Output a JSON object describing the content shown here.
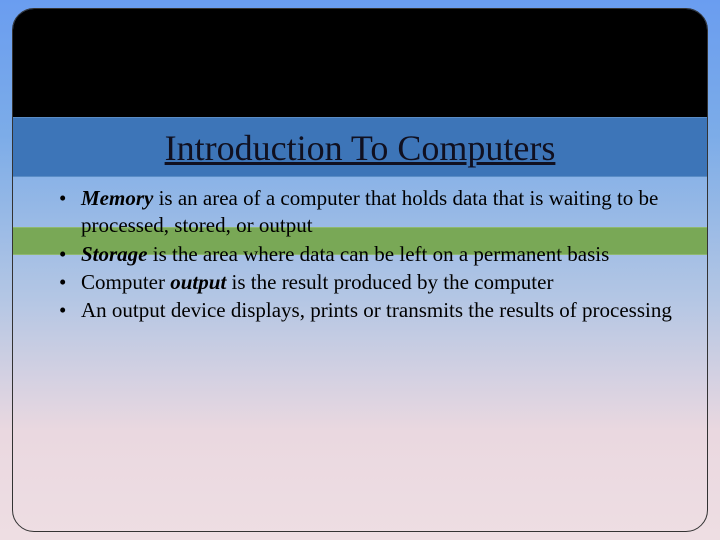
{
  "title": "Introduction To Computers",
  "bullets": {
    "b0": {
      "term": "Memory",
      "rest": " is an area of a computer that holds data that is waiting to be processed, stored, or output"
    },
    "b1": {
      "term": "Storage",
      "rest": " is the area where data can be left on a permanent basis"
    },
    "b2": {
      "pre": "Computer ",
      "term": "output",
      "rest": " is the result produced by the computer"
    },
    "b3": {
      "rest": "An output device displays, prints or transmits the results of processing"
    }
  }
}
